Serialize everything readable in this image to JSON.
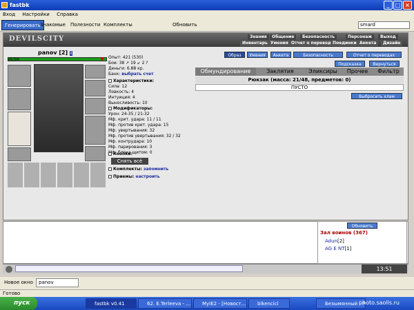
{
  "window": {
    "title": "fastbk"
  },
  "menu": [
    "Вход",
    "Настройки",
    "Справка"
  ],
  "toolbar": {
    "generate": "Генерировать",
    "tabs": [
      "Знакомые",
      "Полезности",
      "Комплекты"
    ],
    "refresh": "Обновить",
    "search_value": "smard"
  },
  "game": {
    "logo": "DEVILSCITY",
    "nav_top": [
      "Знания",
      "Общение",
      "Безопасность",
      "Персонаж",
      "Выход"
    ],
    "nav_bottom": [
      "Инвентарь",
      "Умения",
      "Отчет о переводах",
      "Поединки",
      "Анкета",
      "Дизайн"
    ],
    "char_buttons": [
      "Образ",
      "Умения",
      "Анкета",
      "Безопасность",
      "Отчет о переводах"
    ],
    "hint": "Подсказка",
    "back": "Вернуться",
    "char": {
      "name": "panov",
      "level": "[2]",
      "hp": "96/96",
      "exp": "Опыт: 421 (530)",
      "fights": "Бои: 38 ↗ 19 ↙ 2 ?",
      "money": "Деньги: 6.88 кр.",
      "bank_label": "Банк:",
      "bank_link": "выбрать счет"
    },
    "sections": {
      "characteristics": "Характеристики:",
      "modifiers": "Модификаторы:",
      "buttons": "Кнопки:",
      "sets": "Комплекты:",
      "sets_link": "запомнить",
      "techniques": "Приемы:",
      "techniques_link": "настроить"
    },
    "stats": [
      "Сила: 12",
      "Ловкость: 4",
      "Интуиция: 4",
      "Выносливость: 10"
    ],
    "mods": [
      "Урон: 24-35 / 21-32",
      "Мф. крит. удара: 11 / 11",
      "Мф. против крит. удара: 15",
      "Мф. увертывания: 32",
      "Мф. против увертывания: 32 / 32",
      "Мф. контрудара: 10",
      "Мф. парирования: 3",
      "Мф. блока щитом: 0"
    ],
    "remove_all": "Снять всё",
    "inv_tabs": [
      "Обмундирование",
      "Заклятия",
      "Эликсиры",
      "Прочее",
      "Фильтр"
    ],
    "bag": "Рюкзак (масса: 21/48, предметов: 0)",
    "empty": "ПУСТО",
    "throw_junk": "Выбросить хлам"
  },
  "chat": {
    "refresh": "Обновить",
    "room": "Зал воинов (367)",
    "users": [
      {
        "name": "Adun",
        "level": "[2]"
      },
      {
        "name": "AG E NT",
        "level": "[1]"
      }
    ],
    "time": "13:51"
  },
  "bottom": {
    "new_window": "Новое окно",
    "tab": "panov"
  },
  "status": "Готово",
  "taskbar": {
    "start": "пуск",
    "tasks": [
      "fastbk v0.41",
      "62. E.Terleeva - ...",
      "MyIE2 - [Новост...",
      "blkencicl",
      "Безымянный - Paint"
    ]
  },
  "watermark": "photo.saolls.ru"
}
